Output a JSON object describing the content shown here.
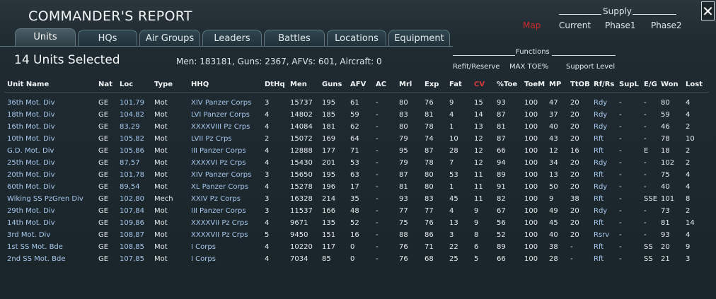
{
  "window": {
    "title": "COMMANDER'S REPORT",
    "close_label": "✕"
  },
  "supply": {
    "header": "Supply",
    "options": [
      "Map",
      "Current",
      "Phase1",
      "Phase2"
    ],
    "active_option": "Map",
    "active_color": "#cc2a2a"
  },
  "tabs": {
    "items": [
      "Units",
      "HQs",
      "Air Groups",
      "Leaders",
      "Battles",
      "Locations",
      "Equipment"
    ],
    "active": "Units"
  },
  "summary": {
    "selected": "14 Units Selected",
    "stats": "Men: 183181, Guns: 2367, AFVs: 601, Aircraft: 0"
  },
  "functions": {
    "header": "Functions",
    "buttons": [
      "Refit/Reserve",
      "MAX TOE%",
      "Support Level"
    ]
  },
  "table": {
    "columns": [
      "Unit Name",
      "Nat",
      "Loc",
      "Type",
      "HHQ",
      "DtHq",
      "Men",
      "Guns",
      "AFV",
      "AC",
      "Mrl",
      "Exp",
      "Fat",
      "CV",
      "%Toe",
      "ToeM",
      "MP",
      "TtOB",
      "Rf/Rs",
      "SupL",
      "E/G",
      "Won",
      "Lost"
    ],
    "highlight_column": "CV",
    "rows": [
      [
        "36th Mot. Div",
        "GE",
        "101,79",
        "Mot",
        "XIV Panzer Corps",
        "3",
        "15737",
        "195",
        "61",
        "-",
        "80",
        "76",
        "9",
        "15",
        "93",
        "100",
        "47",
        "20",
        "Rdy",
        "-",
        "-",
        "80",
        "4"
      ],
      [
        "18th Mot. Div",
        "GE",
        "104,82",
        "Mot",
        "LVI Panzer Corps",
        "4",
        "14802",
        "185",
        "59",
        "-",
        "83",
        "81",
        "4",
        "14",
        "87",
        "100",
        "37",
        "20",
        "Rdy",
        "-",
        "-",
        "59",
        "4"
      ],
      [
        "16th Mot. Div",
        "GE",
        "83,29",
        "Mot",
        "XXXXVIII Pz Crps",
        "4",
        "14084",
        "181",
        "62",
        "-",
        "80",
        "78",
        "1",
        "13",
        "81",
        "100",
        "40",
        "20",
        "Rdy",
        "-",
        "-",
        "46",
        "2"
      ],
      [
        "10th Mot. Div",
        "GE",
        "105,82",
        "Mot",
        "LVII Pz Crps",
        "2",
        "15072",
        "169",
        "64",
        "-",
        "79",
        "74",
        "10",
        "12",
        "87",
        "100",
        "43",
        "20",
        "Rft",
        "-",
        "-",
        "78",
        "10"
      ],
      [
        "G.D. Mot. Div",
        "GE",
        "105,86",
        "Mot",
        "III Panzer Corps",
        "4",
        "12888",
        "177",
        "71",
        "-",
        "95",
        "87",
        "28",
        "12",
        "66",
        "100",
        "12",
        "16",
        "Rft",
        "-",
        "E",
        "18",
        "2"
      ],
      [
        "25th Mot. Div",
        "GE",
        "87,57",
        "Mot",
        "XXXXVI Pz Crps",
        "4",
        "15430",
        "201",
        "53",
        "-",
        "79",
        "78",
        "7",
        "12",
        "94",
        "100",
        "34",
        "20",
        "Rdy",
        "-",
        "-",
        "102",
        "2"
      ],
      [
        "20th Mot. Div",
        "GE",
        "101,78",
        "Mot",
        "XIV Panzer Corps",
        "3",
        "15650",
        "195",
        "63",
        "-",
        "87",
        "80",
        "53",
        "11",
        "89",
        "100",
        "13",
        "20",
        "Rft",
        "-",
        "-",
        "75",
        "4"
      ],
      [
        "60th Mot. Div",
        "GE",
        "89,54",
        "Mot",
        "XL Panzer Corps",
        "4",
        "15278",
        "196",
        "17",
        "-",
        "81",
        "80",
        "1",
        "11",
        "91",
        "100",
        "50",
        "20",
        "Rdy",
        "-",
        "-",
        "40",
        "4"
      ],
      [
        "Wiking SS PzGren Div",
        "GE",
        "102,80",
        "Mech",
        "XXIV Pz Corps",
        "3",
        "16328",
        "214",
        "35",
        "-",
        "93",
        "83",
        "45",
        "11",
        "82",
        "100",
        "9",
        "38",
        "Rft",
        "-",
        "SSE",
        "101",
        "8"
      ],
      [
        "29th Mot. Div",
        "GE",
        "107,84",
        "Mot",
        "III Panzer Corps",
        "3",
        "11537",
        "166",
        "48",
        "-",
        "77",
        "77",
        "4",
        "9",
        "67",
        "100",
        "49",
        "20",
        "Rdy",
        "-",
        "-",
        "73",
        "2"
      ],
      [
        "14th Mot. Div",
        "GE",
        "109,86",
        "Mot",
        "XXXXVII Pz Crps",
        "4",
        "9671",
        "135",
        "52",
        "-",
        "75",
        "76",
        "13",
        "9",
        "56",
        "100",
        "45",
        "20",
        "Rft",
        "-",
        "-",
        "81",
        "14"
      ],
      [
        "3rd Mot. Div",
        "GE",
        "108,87",
        "Mot",
        "XXXXVII Pz Crps",
        "5",
        "9450",
        "151",
        "16",
        "-",
        "88",
        "86",
        "3",
        "8",
        "52",
        "100",
        "40",
        "20",
        "Rsrv",
        "-",
        "-",
        "93",
        "4"
      ],
      [
        "1st SS Mot. Bde",
        "GE",
        "108,85",
        "Mot",
        "I Corps",
        "4",
        "10220",
        "117",
        "0",
        "-",
        "76",
        "71",
        "22",
        "6",
        "89",
        "100",
        "38",
        "-",
        "Rft",
        "-",
        "SS",
        "20",
        "9"
      ],
      [
        "2nd SS Mot. Bde",
        "GE",
        "107,85",
        "Mot",
        "I Corps",
        "4",
        "7034",
        "85",
        "0",
        "-",
        "76",
        "68",
        "25",
        "5",
        "66",
        "100",
        "28",
        "-",
        "Rft",
        "-",
        "SS",
        "21",
        "3"
      ]
    ]
  }
}
